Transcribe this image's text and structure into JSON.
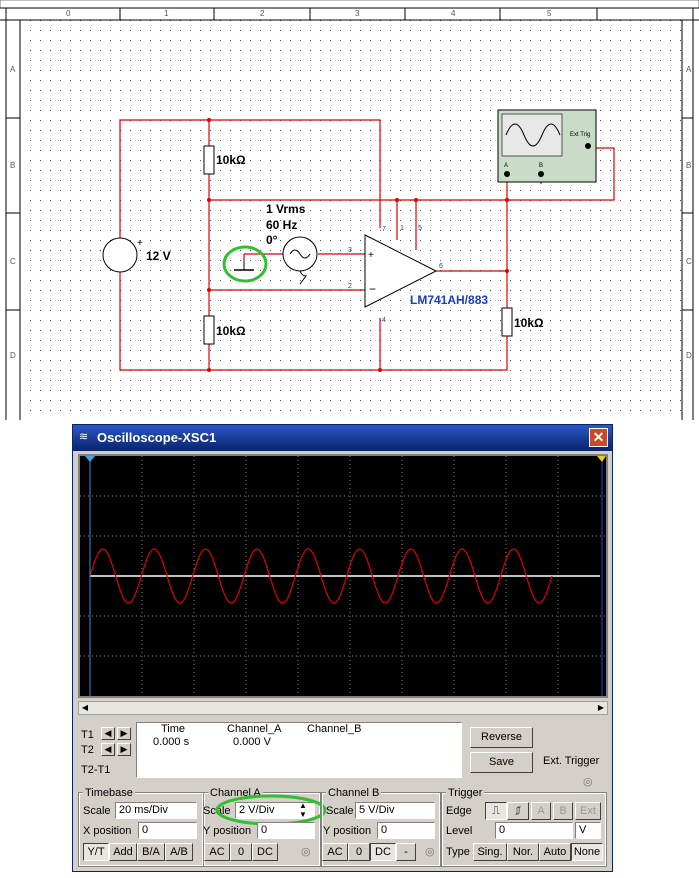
{
  "schematic": {
    "ruler_top": [
      "0",
      "1",
      "2",
      "3",
      "4",
      "5"
    ],
    "ruler_left": [
      "A",
      "B",
      "C",
      "D"
    ],
    "resistor_top": "10kΩ",
    "resistor_bottom": "10kΩ",
    "resistor_out": "10kΩ",
    "dc_source": "12 V",
    "ac_amp": "1 Vrms",
    "ac_freq": "60 Hz",
    "ac_phase": "0°",
    "opamp_label": "LM741AH/883",
    "pin7": "7",
    "pin1": "1",
    "pin5": "5",
    "pin3": "3",
    "pin2": "2",
    "pin4": "4",
    "pin6": "6",
    "scope_ext_trig": "Ext Trig",
    "scope_a": "A",
    "scope_b": "B",
    "highlight_color": "#2fbf2f",
    "wire_color": "#e00000"
  },
  "scope_window": {
    "title": "Oscilloscope-XSC1",
    "close": "✕",
    "trace_color": "#e00000",
    "readout": {
      "t1": "T1",
      "t2": "T2",
      "t2t1": "T2-T1",
      "col_time": "Time",
      "col_a": "Channel_A",
      "col_b": "Channel_B",
      "time_val": "0.000 s",
      "a_val": "0.000 V"
    },
    "reverse_btn": "Reverse",
    "save_btn": "Save",
    "ext_trigger": "Ext. Trigger",
    "timebase": {
      "title": "Timebase",
      "scale_label": "Scale",
      "scale": "20 ms/Div",
      "xpos_label": "X position",
      "xpos": "0",
      "yt": "Y/T",
      "add": "Add",
      "ba": "B/A",
      "ab": "A/B"
    },
    "channel_a": {
      "title": "Channel A",
      "scale_label": "Scale",
      "scale": "2  V/Div",
      "ypos_label": "Y position",
      "ypos": "0",
      "ac": "AC",
      "zero": "0",
      "dc": "DC"
    },
    "channel_b": {
      "title": "Channel B",
      "scale_label": "Scale",
      "scale": "5  V/Div",
      "ypos_label": "Y position",
      "ypos": "0",
      "ac": "AC",
      "zero": "0",
      "dc": "DC",
      "minus": "-"
    },
    "trigger": {
      "title": "Trigger",
      "edge_label": "Edge",
      "level_label": "Level",
      "level": "0",
      "unit": "V",
      "type_label": "Type",
      "a": "A",
      "b": "B",
      "ext": "Ext",
      "sing": "Sing.",
      "nor": "Nor.",
      "auto": "Auto",
      "none": "None"
    }
  }
}
